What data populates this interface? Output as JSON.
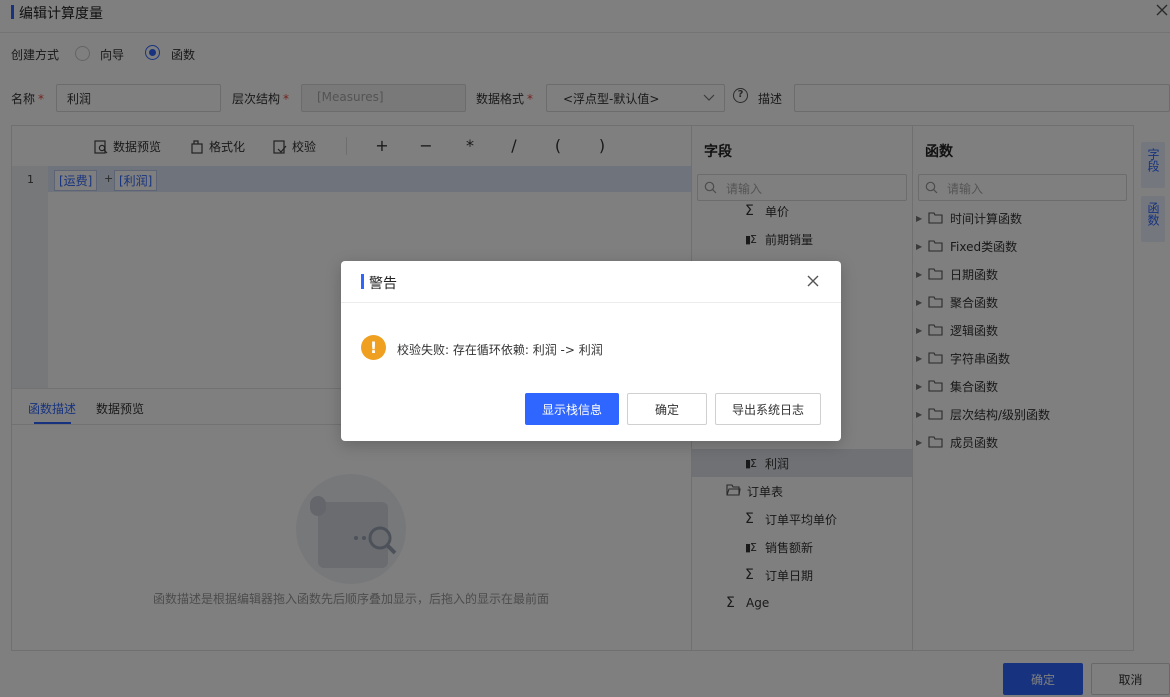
{
  "window": {
    "title": "编辑计算度量"
  },
  "creation": {
    "label": "创建方式",
    "options": [
      "向导",
      "函数"
    ],
    "selected": "函数"
  },
  "form": {
    "name_label": "名称",
    "name_value": "利润",
    "hierarchy_label": "层次结构",
    "hierarchy_value": "[Measures]",
    "format_label": "数据格式",
    "format_value": "<浮点型-默认值>",
    "desc_label": "描述",
    "desc_value": ""
  },
  "toolbar": {
    "preview": "数据预览",
    "format": "格式化",
    "validate": "校验",
    "ops": [
      "+",
      "−",
      "*",
      "/",
      "(",
      ")"
    ]
  },
  "editor": {
    "line_number": "1",
    "tokens": [
      "[运费]",
      "+",
      "[利润]"
    ]
  },
  "bottom_tabs": {
    "items": [
      "函数描述",
      "数据预览"
    ],
    "active": "函数描述"
  },
  "empty_hint": "函数描述是根据编辑器拖入函数先后顺序叠加显示，后拖入的显示在最前面",
  "fields_panel": {
    "title": "字段",
    "search_placeholder": "请输入",
    "items": [
      {
        "label": "单价",
        "type": "sum",
        "indent": 2
      },
      {
        "label": "前期销量",
        "type": "calc",
        "indent": 2
      },
      {
        "label": "利润",
        "type": "calc",
        "indent": 2,
        "selected": true
      },
      {
        "label": "订单表",
        "type": "folder",
        "indent": 1
      },
      {
        "label": "订单平均单价",
        "type": "sum",
        "indent": 2
      },
      {
        "label": "销售额新",
        "type": "calc",
        "indent": 2
      },
      {
        "label": "订单日期",
        "type": "sum",
        "indent": 2
      },
      {
        "label": "Age",
        "type": "sum",
        "indent": 1
      }
    ]
  },
  "functions_panel": {
    "title": "函数",
    "search_placeholder": "请输入",
    "items": [
      "时间计算函数",
      "Fixed类函数",
      "日期函数",
      "聚合函数",
      "逻辑函数",
      "字符串函数",
      "集合函数",
      "层次结构/级别函数",
      "成员函数"
    ]
  },
  "side_tabs": [
    "字段",
    "函数"
  ],
  "footer": {
    "ok": "确定",
    "cancel": "取消"
  },
  "dialog": {
    "title": "警告",
    "message": "校验失败: 存在循环依赖: 利润 -> 利润",
    "buttons": {
      "stack": "显示栈信息",
      "ok": "确定",
      "export": "导出系统日志"
    }
  },
  "colors": {
    "accent": "#2f66ff",
    "warning": "#f0a020"
  }
}
